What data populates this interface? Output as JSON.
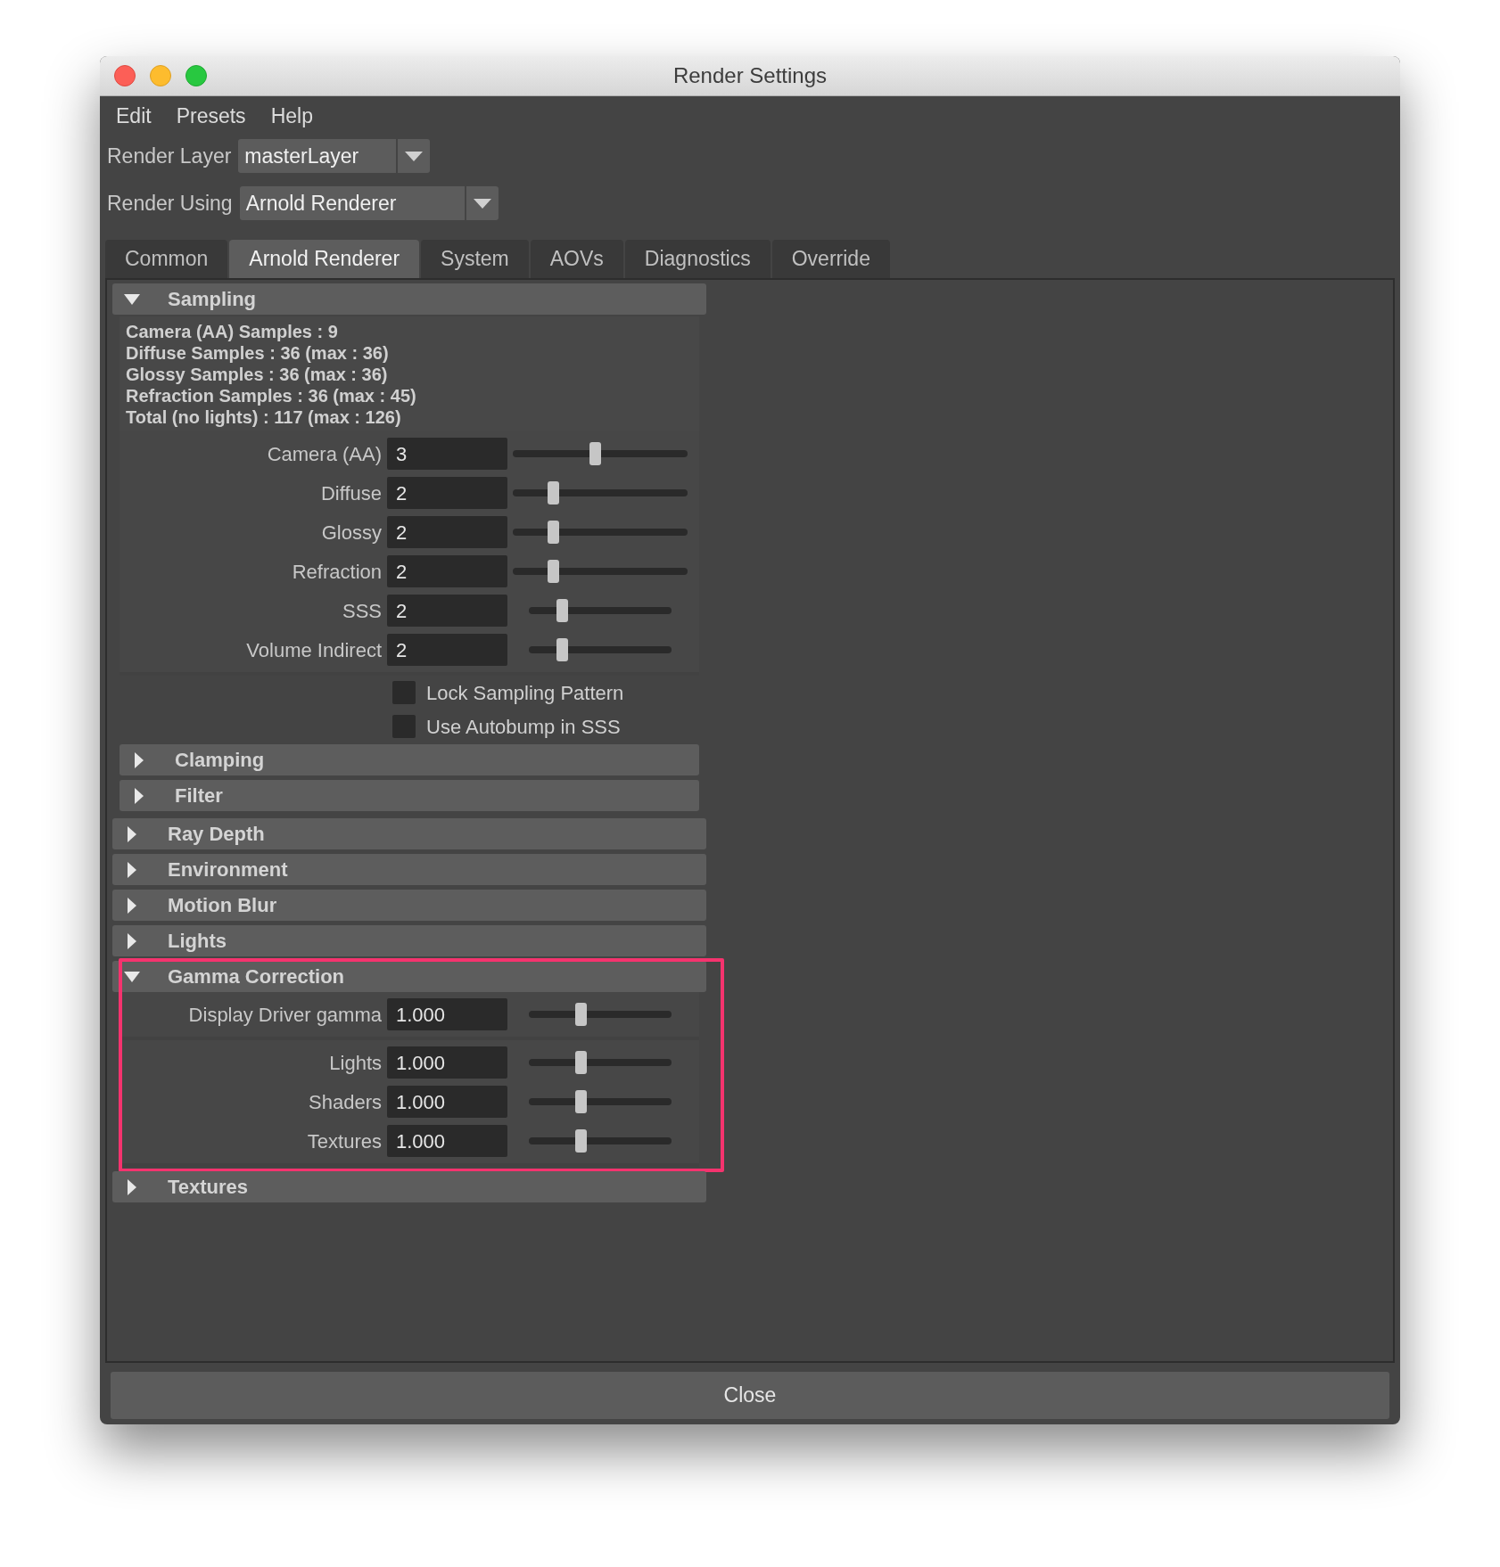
{
  "window": {
    "title": "Render Settings"
  },
  "menu": [
    "Edit",
    "Presets",
    "Help"
  ],
  "selectors": [
    {
      "label": "Render Layer",
      "value": "masterLayer"
    },
    {
      "label": "Render Using",
      "value": "Arnold Renderer"
    }
  ],
  "tabs": [
    {
      "label": "Common",
      "selected": false
    },
    {
      "label": "Arnold Renderer",
      "selected": true
    },
    {
      "label": "System",
      "selected": false
    },
    {
      "label": "AOVs",
      "selected": false
    },
    {
      "label": "Diagnostics",
      "selected": false
    },
    {
      "label": "Override",
      "selected": false
    }
  ],
  "sections": [
    {
      "title": "Sampling",
      "expanded": true,
      "highlighted": false,
      "stats": [
        "Camera (AA) Samples : 9",
        "Diffuse Samples : 36 (max : 36)",
        "Glossy Samples : 36 (max : 36)",
        "Refraction Samples : 36 (max : 45)",
        "Total (no lights) : 117 (max : 126)"
      ],
      "param_groups": [
        [
          {
            "label": "Camera (AA)",
            "value": "3",
            "kind": "wide",
            "level": 0.47
          },
          {
            "label": "Diffuse",
            "value": "2",
            "kind": "wide",
            "level": 0.23
          },
          {
            "label": "Glossy",
            "value": "2",
            "kind": "wide",
            "level": 0.23
          },
          {
            "label": "Refraction",
            "value": "2",
            "kind": "wide",
            "level": 0.23
          },
          {
            "label": "SSS",
            "value": "2",
            "kind": "short",
            "level": 0.23
          },
          {
            "label": "Volume Indirect",
            "value": "2",
            "kind": "short",
            "level": 0.23
          }
        ]
      ],
      "checkboxes": [
        {
          "label": "Lock Sampling Pattern",
          "checked": false
        },
        {
          "label": "Use Autobump in SSS",
          "checked": false
        }
      ],
      "subsections": [
        {
          "title": "Clamping",
          "expanded": false
        },
        {
          "title": "Filter",
          "expanded": false
        }
      ]
    },
    {
      "title": "Ray Depth",
      "expanded": false,
      "highlighted": false
    },
    {
      "title": "Environment",
      "expanded": false,
      "highlighted": false
    },
    {
      "title": "Motion Blur",
      "expanded": false,
      "highlighted": false
    },
    {
      "title": "Lights",
      "expanded": false,
      "highlighted": false
    },
    {
      "title": "Gamma Correction",
      "expanded": true,
      "highlighted": true,
      "param_groups": [
        [
          {
            "label": "Display Driver gamma",
            "value": "1.000",
            "kind": "short",
            "level": 0.36
          }
        ],
        [
          {
            "label": "Lights",
            "value": "1.000",
            "kind": "short",
            "level": 0.36
          },
          {
            "label": "Shaders",
            "value": "1.000",
            "kind": "short",
            "level": 0.36
          },
          {
            "label": "Textures",
            "value": "1.000",
            "kind": "short",
            "level": 0.36
          }
        ]
      ]
    },
    {
      "title": "Textures",
      "expanded": false,
      "highlighted": false
    }
  ],
  "close_button": "Close"
}
